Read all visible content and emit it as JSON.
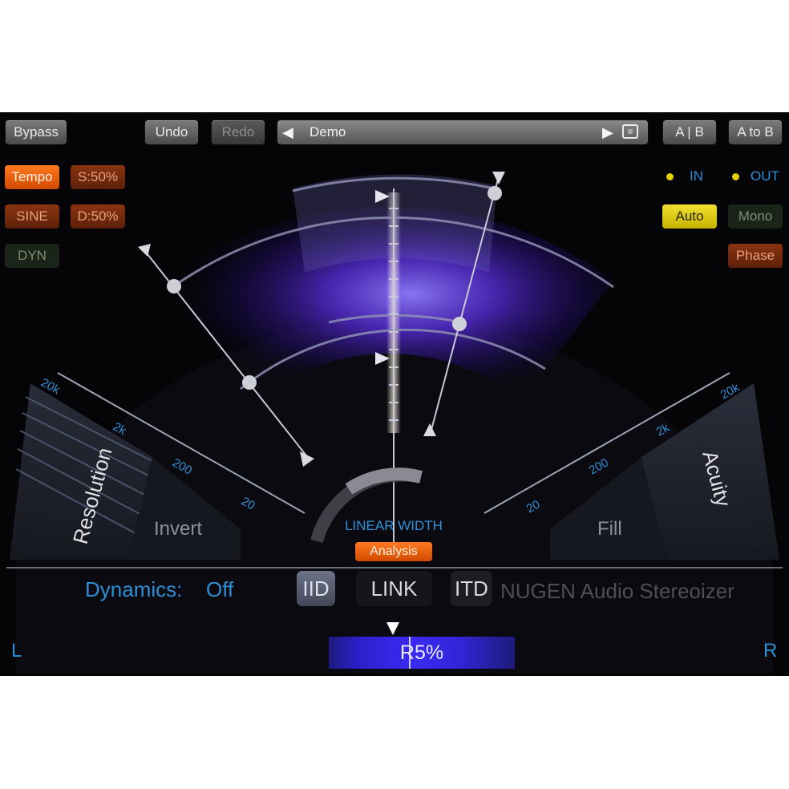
{
  "toolbar": {
    "bypass": "Bypass",
    "undo": "Undo",
    "redo": "Redo",
    "preset": "Demo",
    "ab": "A | B",
    "a_to_b": "A to B"
  },
  "left_options": {
    "tempo": "Tempo",
    "s_percent": "S:50%",
    "sine": "SINE",
    "d_percent": "D:50%",
    "dyn": "DYN"
  },
  "right_options": {
    "in_label": "IN",
    "out_label": "OUT",
    "auto": "Auto",
    "mono": "Mono",
    "phase": "Phase"
  },
  "dial": {
    "left_ticks": [
      "20k",
      "2k",
      "200",
      "20"
    ],
    "right_ticks": [
      "20",
      "200",
      "2k",
      "20k"
    ],
    "resolution": "Resolution",
    "invert": "Invert",
    "fill": "Fill",
    "acuity": "Acuity",
    "linear_width": "LINEAR WIDTH",
    "analysis": "Analysis"
  },
  "bottom": {
    "dynamics_label": "Dynamics:",
    "dynamics_value": "Off",
    "iid": "IID",
    "link": "LINK",
    "itd": "ITD",
    "product": "NUGEN Audio Stereoizer",
    "left": "L",
    "right": "R",
    "balance": "R5%"
  },
  "colors": {
    "accent_blue": "#2f8fd6",
    "orange": "#ff7a20",
    "yellow": "#e3d200",
    "spectrum": "#6a3cff"
  }
}
